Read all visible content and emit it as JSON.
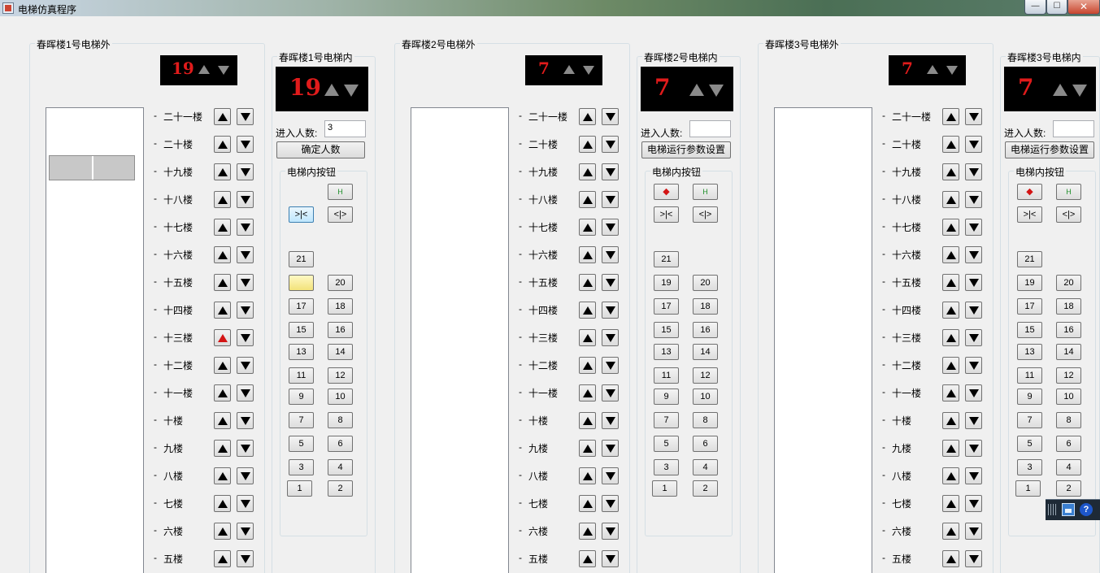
{
  "window": {
    "title": "电梯仿真程序",
    "min_glyph": "—",
    "max_glyph": "☐",
    "close_glyph": "✕"
  },
  "floors": [
    "二十一楼",
    "二十楼",
    "十九楼",
    "十八楼",
    "十七楼",
    "十六楼",
    "十五楼",
    "十四楼",
    "十三楼",
    "十二楼",
    "十一楼",
    "十楼",
    "九楼",
    "八楼",
    "七楼",
    "六楼",
    "五楼"
  ],
  "car_buttons": {
    "open_glyph": "<|>",
    "close_glyph": ">|<",
    "phone_glyph": "H",
    "alarm_glyph": "◆",
    "numbers": [
      "21",
      "20",
      "19",
      "18",
      "17",
      "16",
      "15",
      "14",
      "13",
      "12",
      "11",
      "10",
      "9",
      "8",
      "7",
      "6",
      "5",
      "4",
      "3",
      "2",
      "1"
    ]
  },
  "elevators": [
    {
      "outside_title": "春晖楼1号电梯外",
      "inside_title": "春晖楼1号电梯内",
      "floor_display": "19",
      "inside_display": "19",
      "people_label": "进入人数:",
      "people_value": "3",
      "action_button": "确定人数",
      "panel_title": "电梯内按钮",
      "car_position_floor": "十九楼",
      "lit_up_call_floor": "十三楼",
      "lit_car_button": "19",
      "has_alarm_button": false
    },
    {
      "outside_title": "春晖楼2号电梯外",
      "inside_title": "春晖楼2号电梯内",
      "floor_display": "7",
      "inside_display": "7",
      "people_label": "进入人数:",
      "people_value": "",
      "action_button": "电梯运行参数设置",
      "panel_title": "电梯内按钮",
      "has_alarm_button": true
    },
    {
      "outside_title": "春晖楼3号电梯外",
      "inside_title": "春晖楼3号电梯内",
      "floor_display": "7",
      "inside_display": "7",
      "people_label": "进入人数:",
      "people_value": "",
      "action_button": "电梯运行参数设置",
      "panel_title": "电梯内按钮",
      "has_alarm_button": true
    }
  ],
  "colors": {
    "display_bg": "#000000",
    "display_digits": "#e01b1b",
    "display_arrows": "#8a8a8a",
    "lit_call_arrow": "#d31414",
    "lit_car_button": "#f2e27a"
  },
  "tray": {
    "help_glyph": "?"
  }
}
